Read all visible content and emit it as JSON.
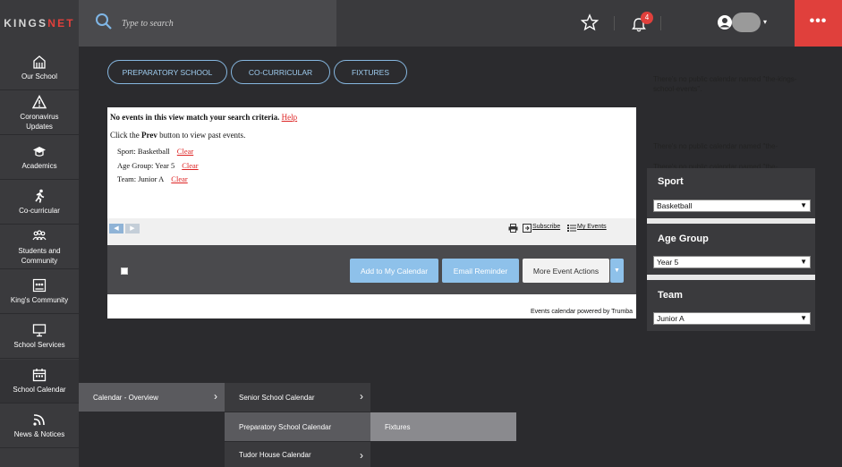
{
  "header": {
    "logo_main": "KINGS",
    "logo_accent": "NET",
    "search_placeholder": "Type to search",
    "notification_count": "4",
    "more_label": "•••",
    "avatar_caret": "▾"
  },
  "sidebar": {
    "items": [
      {
        "label": "Our School",
        "icon": "school-icon"
      },
      {
        "label": "Coronavirus Updates",
        "icon": "warning-icon"
      },
      {
        "label": "Academics",
        "icon": "graduation-cap-icon"
      },
      {
        "label": "Co-curricular",
        "icon": "runner-icon"
      },
      {
        "label": "Students and Community",
        "icon": "people-icon"
      },
      {
        "label": "King's Community",
        "icon": "community-icon"
      },
      {
        "label": "School Services",
        "icon": "monitor-icon"
      },
      {
        "label": "School Calendar",
        "icon": "calendar-icon"
      },
      {
        "label": "News & Notices",
        "icon": "rss-icon"
      }
    ]
  },
  "tabs": [
    "PREPARATORY SCHOOL",
    "CO-CURRICULAR",
    "FIXTURES"
  ],
  "calendar": {
    "no_events": "No events in this view match your search criteria.",
    "help": "Help",
    "click_the": "Click the",
    "prev": "Prev",
    "button_to_view": "button to view past events.",
    "filters": [
      {
        "text": "Sport: Basketball",
        "clear": "Clear"
      },
      {
        "text": "Age Group: Year 5",
        "clear": "Clear"
      },
      {
        "text": "Team: Junior A",
        "clear": "Clear"
      }
    ],
    "prev_arrow": "◀",
    "next_arrow": "▶",
    "subscribe": "Subscribe",
    "my_events": "My Events",
    "add_to_calendar": "Add to My Calendar",
    "email_reminder": "Email Reminder",
    "more_event_actions": "More Event Actions",
    "more_caret": "▼",
    "powered_by": "Events calendar powered by Trumba"
  },
  "right_column": {
    "message": "There's no public calendar named \"the-kings-school-events\".",
    "message_partial": "There's no public calendar named \"the-"
  },
  "filter_panel": {
    "sport_label": "Sport",
    "sport_value": "Basketball",
    "age_group_label": "Age Group",
    "age_group_value": "Year 5",
    "team_label": "Team",
    "team_value": "Junior A",
    "arrow": "▼"
  },
  "menus": {
    "level1": "Calendar - Overview",
    "level2": [
      "Senior School Calendar",
      "Preparatory School Calendar",
      "Tudor House Calendar"
    ],
    "level3": "Fixtures",
    "chevron": "›"
  },
  "colors": {
    "accent_red": "#e0403c",
    "button_blue": "#8ec1ea",
    "tab_blue": "#86b7e0",
    "background": "#2b2b2e"
  }
}
